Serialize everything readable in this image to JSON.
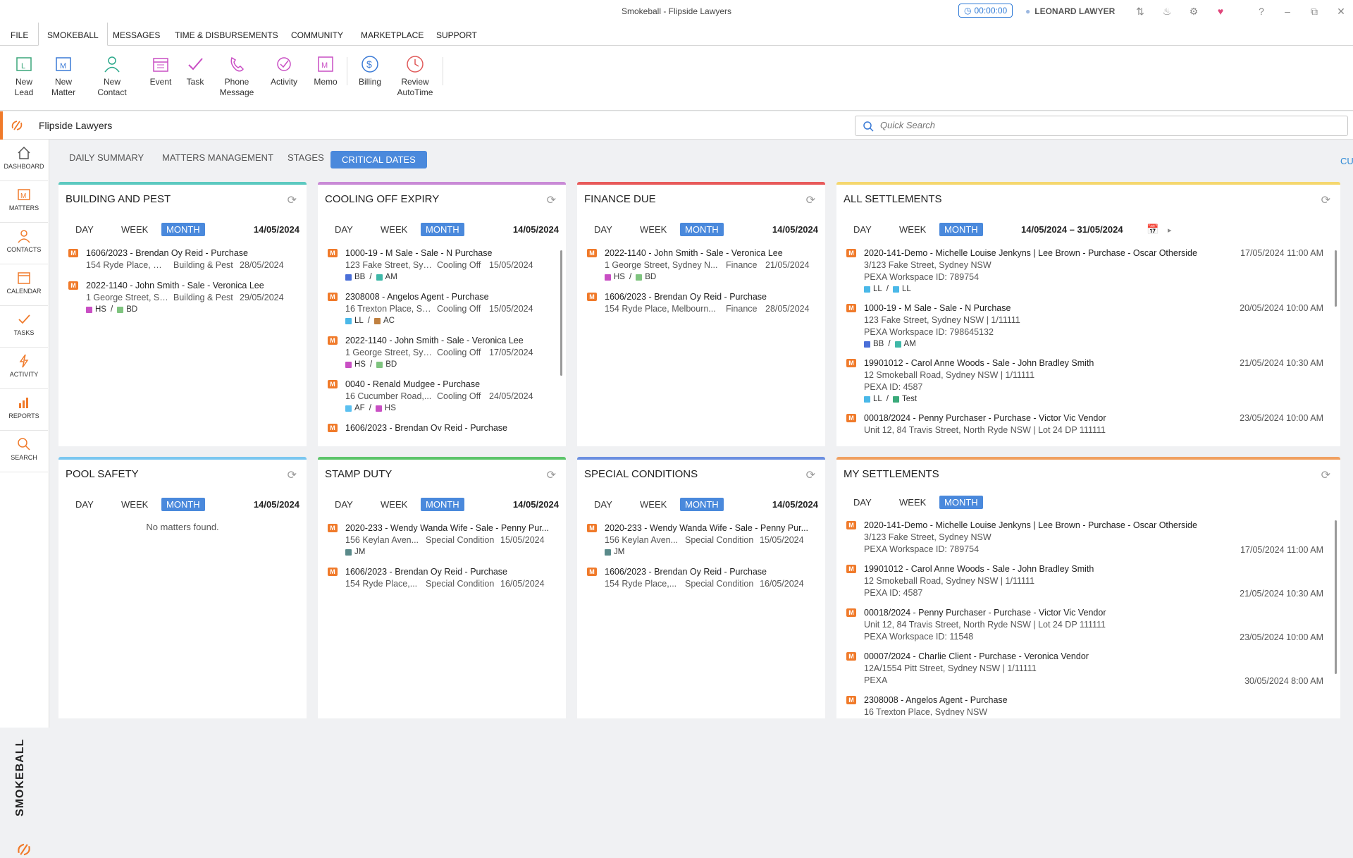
{
  "window": {
    "title": "Smokeball  - Flipside Lawyers",
    "timer": "00:00:00",
    "user": "LEONARD LAWYER"
  },
  "menu": [
    "FILE",
    "SMOKEBALL",
    "MESSAGES",
    "TIME & DISBURSEMENTS",
    "COMMUNITY",
    "MARKETPLACE",
    "SUPPORT"
  ],
  "ribbon": [
    {
      "line1": "New",
      "line2": "Lead",
      "icon": "new-lead-icon"
    },
    {
      "line1": "New",
      "line2": "Matter",
      "icon": "new-matter-icon"
    },
    {
      "line1": "New",
      "line2": "Contact",
      "icon": "new-contact-icon"
    },
    {
      "line1": "Event",
      "line2": "",
      "icon": "event-icon"
    },
    {
      "line1": "Task",
      "line2": "",
      "icon": "task-icon"
    },
    {
      "line1": "Phone",
      "line2": "Message",
      "icon": "phone-message-icon"
    },
    {
      "line1": "Activity",
      "line2": "",
      "icon": "activity-icon"
    },
    {
      "line1": "Memo",
      "line2": "",
      "icon": "memo-icon"
    },
    {
      "line1": "Billing",
      "line2": "",
      "icon": "billing-icon"
    },
    {
      "line1": "Review",
      "line2": "AutoTime",
      "icon": "review-autotime-icon"
    }
  ],
  "firm": {
    "name": "Flipside Lawyers"
  },
  "search": {
    "placeholder": "Quick Search"
  },
  "nav": [
    "DASHBOARD",
    "MATTERS",
    "CONTACTS",
    "CALENDAR",
    "TASKS",
    "ACTIVITY",
    "REPORTS",
    "SEARCH"
  ],
  "brand": "SMOKEBALL",
  "tabs": [
    "DAILY SUMMARY",
    "MATTERS MANAGEMENT",
    "STAGES",
    "CRITICAL DATES"
  ],
  "customise": "CUSTOMISE",
  "seg": {
    "day": "DAY",
    "week": "WEEK",
    "month": "MONTH"
  },
  "cards": {
    "building": {
      "title": "BUILDING AND PEST",
      "date": "14/05/2024",
      "color": "#5cc9c0",
      "items": [
        {
          "title": "1606/2023 - Brendan Oy Reid - Purchase",
          "addr": "154 Ryde Place, Me...",
          "type": "Building & Pest",
          "date": "28/05/2024"
        },
        {
          "title": "2022-1140 - John Smith - Sale - Veronica Lee",
          "addr": "1 George Street, Sy...",
          "type": "Building & Pest",
          "date": "29/05/2024",
          "tags": "HS / BD"
        }
      ]
    },
    "cooling": {
      "title": "COOLING OFF EXPIRY",
      "date": "14/05/2024",
      "color": "#c98ad6",
      "items": [
        {
          "title": "1000-19 - M Sale - Sale - N Purchase",
          "addr": "123 Fake Street, Syd...",
          "type": "Cooling Off",
          "date": "15/05/2024",
          "tags": "BB / AM"
        },
        {
          "title": "2308008 - Angelos Agent - Purchase",
          "addr": "16 Trexton Place, Sy...",
          "type": "Cooling Off",
          "date": "15/05/2024",
          "tags": "LL / AC"
        },
        {
          "title": "2022-1140 - John Smith - Sale - Veronica Lee",
          "addr": "1 George Street, Syd...",
          "type": "Cooling Off",
          "date": "17/05/2024",
          "tags": "HS / BD"
        },
        {
          "title": "0040 - Renald Mudgee - Purchase",
          "addr": "16 Cucumber Road,...",
          "type": "Cooling Off",
          "date": "24/05/2024",
          "tags": "AF / HS"
        },
        {
          "title": "1606/2023 - Brendan Ov Reid - Purchase",
          "addr": "",
          "type": "",
          "date": ""
        }
      ]
    },
    "finance": {
      "title": "FINANCE DUE",
      "date": "14/05/2024",
      "color": "#e85a5a",
      "items": [
        {
          "title": "2022-1140 - John Smith - Sale - Veronica Lee",
          "addr": "1 George Street, Sydney N...",
          "type": "Finance",
          "date": "21/05/2024",
          "tags": "HS / BD"
        },
        {
          "title": "1606/2023 - Brendan Oy Reid - Purchase",
          "addr": "154 Ryde Place, Melbourn...",
          "type": "Finance",
          "date": "28/05/2024"
        }
      ]
    },
    "allsettle": {
      "title": "ALL SETTLEMENTS",
      "range": "14/05/2024 – 31/05/2024",
      "color": "#f5d76e",
      "items": [
        {
          "title": "2020-141-Demo - Michelle Louise Jenkyns | Lee Brown - Purchase - Oscar Otherside",
          "time": "17/05/2024 11:00 AM",
          "l2": "3/123 Fake Street, Sydney NSW",
          "l3": "PEXA Workspace ID: 789754",
          "tags": "LL / LL"
        },
        {
          "title": "1000-19 - M Sale - Sale - N Purchase",
          "time": "20/05/2024 10:00 AM",
          "l2": "123 Fake Street, Sydney NSW | 1/11111",
          "l3": "PEXA Workspace ID: 798645132",
          "tags": "BB / AM"
        },
        {
          "title": "19901012 - Carol Anne Woods - Sale - John Bradley Smith",
          "time": "21/05/2024 10:30 AM",
          "l2": "12 Smokeball Road, Sydney NSW | 1/11111",
          "l3": "PEXA ID: 4587",
          "tags": "LL / Test"
        },
        {
          "title": "00018/2024 - Penny Purchaser - Purchase - Victor Vic Vendor",
          "time": "23/05/2024 10:00 AM",
          "l2": "Unit 12, 84 Travis Street, North Ryde NSW | Lot 24 DP 111111",
          "l3": "",
          "tags": ""
        }
      ]
    },
    "pool": {
      "title": "POOL SAFETY",
      "date": "14/05/2024",
      "color": "#7ac7f0",
      "empty": "No matters found."
    },
    "stamp": {
      "title": "STAMP DUTY",
      "date": "14/05/2024",
      "color": "#5cc46a",
      "items": [
        {
          "title": "2020-233 - Wendy Wanda Wife - Sale - Penny Pur...",
          "addr": "156 Keylan Aven...",
          "type": "Special Condition",
          "date": "15/05/2024",
          "tags": "JM"
        },
        {
          "title": "1606/2023 - Brendan Oy Reid - Purchase",
          "addr": "154 Ryde Place,...",
          "type": "Special Condition",
          "date": "16/05/2024"
        }
      ]
    },
    "special": {
      "title": "SPECIAL CONDITIONS",
      "date": "14/05/2024",
      "color": "#6b8fe0",
      "items": [
        {
          "title": "2020-233 - Wendy Wanda Wife - Sale - Penny Pur...",
          "addr": "156 Keylan Aven...",
          "type": "Special Condition",
          "date": "15/05/2024",
          "tags": "JM"
        },
        {
          "title": "1606/2023 - Brendan Oy Reid - Purchase",
          "addr": "154 Ryde Place,...",
          "type": "Special Condition",
          "date": "16/05/2024"
        }
      ]
    },
    "mysettle": {
      "title": "MY SETTLEMENTS",
      "color": "#f0a060",
      "items": [
        {
          "title": "2020-141-Demo - Michelle Louise Jenkyns | Lee Brown - Purchase - Oscar Otherside",
          "l2": "3/123 Fake Street, Sydney NSW",
          "l3": "PEXA Workspace ID: 789754",
          "time": "17/05/2024 11:00 AM"
        },
        {
          "title": "19901012 - Carol Anne Woods - Sale - John Bradley Smith",
          "l2": "12 Smokeball Road, Sydney NSW | 1/11111",
          "l3": "PEXA ID: 4587",
          "time": "21/05/2024 10:30 AM"
        },
        {
          "title": "00018/2024 - Penny Purchaser - Purchase - Victor Vic Vendor",
          "l2": "Unit 12, 84 Travis Street, North Ryde NSW | Lot 24 DP 111111",
          "l3": "PEXA Workspace ID: 11548",
          "time": "23/05/2024 10:00 AM"
        },
        {
          "title": "00007/2024 - Charlie Client - Purchase - Veronica Vendor",
          "l2": "12A/1554 Pitt Street, Sydney NSW | 1/11111",
          "l3": "PEXA",
          "time": "30/05/2024 8:00 AM"
        },
        {
          "title": "2308008 - Angelos Agent - Purchase",
          "l2": "16 Trexton Place, Sydney NSW",
          "l3": "",
          "time": ""
        }
      ]
    }
  },
  "tagColors": {
    "HS": "#c94fc4",
    "BD": "#7fc47f",
    "BB": "#4a6fd8",
    "AM": "#3fb8a8",
    "LL": "#4ab8e8",
    "AC": "#c08040",
    "AF": "#5bc0f0",
    "JM": "#5a8a8a",
    "Test": "#3aaa7a"
  },
  "colors": {
    "accent": "#4a89dc",
    "brand": "#f07a2a"
  }
}
